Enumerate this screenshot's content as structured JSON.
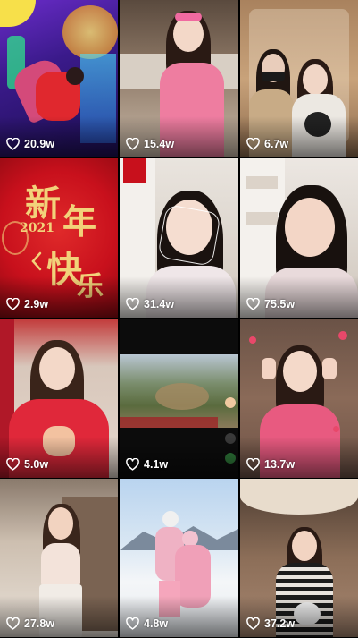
{
  "feed": {
    "items": [
      {
        "likes": "20.9w"
      },
      {
        "likes": "15.4w"
      },
      {
        "likes": "6.7w"
      },
      {
        "likes": "2.9w",
        "overlay_text": {
          "year": "2021",
          "glyph_a": "新",
          "glyph_b": "年",
          "glyph_c": "快",
          "glyph_d": "乐"
        }
      },
      {
        "likes": "31.4w"
      },
      {
        "likes": "75.5w"
      },
      {
        "likes": "5.0w"
      },
      {
        "likes": "4.1w"
      },
      {
        "likes": "13.7w"
      },
      {
        "likes": "27.8w"
      },
      {
        "likes": "4.8w"
      },
      {
        "likes": "37.2w"
      }
    ]
  },
  "colors": {
    "like_icon": "#ffffff",
    "cny_red": "#c8101c",
    "gold": "#f2d27a"
  },
  "icons": {
    "like": "heart-outline-icon",
    "prev_arrow": "chevron-left-icon"
  }
}
